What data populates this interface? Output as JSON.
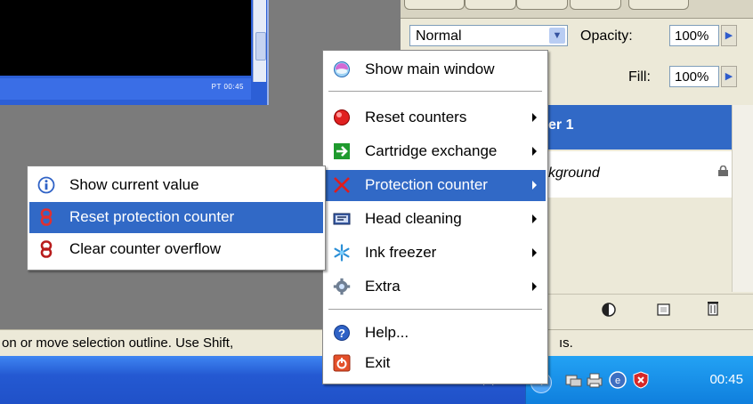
{
  "background": {
    "thumbnail_tray_text": "PT 00:45",
    "layers_panel": {
      "blend_mode": "Normal",
      "opacity_label": "Opacity:",
      "opacity_value": "100%",
      "fill_label": "Fill:",
      "fill_value": "100%",
      "layer_active_name": "er 1",
      "layer_background_name": "kground"
    },
    "status_bar_text": "on or move selection outline.  Use Shift,",
    "status_bar_text_right": "ıs.",
    "tray_clock": "00:45",
    "taskbar_fragment": "PT"
  },
  "main_menu": {
    "items": [
      {
        "label": "Show main window",
        "icon": "main-window-icon",
        "has_submenu": false,
        "highlighted": false
      },
      {
        "label": "Reset counters",
        "icon": "red-ball-icon",
        "has_submenu": true,
        "highlighted": false
      },
      {
        "label": "Cartridge exchange",
        "icon": "green-arrow-icon",
        "has_submenu": true,
        "highlighted": false
      },
      {
        "label": "Protection counter",
        "icon": "red-x-icon",
        "has_submenu": true,
        "highlighted": true
      },
      {
        "label": "Head cleaning",
        "icon": "printer-head-icon",
        "has_submenu": true,
        "highlighted": false
      },
      {
        "label": "Ink freezer",
        "icon": "snowflake-icon",
        "has_submenu": true,
        "highlighted": false
      },
      {
        "label": "Extra",
        "icon": "gear-icon",
        "has_submenu": true,
        "highlighted": false
      },
      {
        "label": "Help...",
        "icon": "help-icon",
        "has_submenu": false,
        "highlighted": false
      },
      {
        "label": "Exit",
        "icon": "exit-icon",
        "has_submenu": false,
        "highlighted": false
      }
    ]
  },
  "sub_menu": {
    "items": [
      {
        "label": "Show current value",
        "icon": "info-icon",
        "highlighted": false
      },
      {
        "label": "Reset protection counter",
        "icon": "chain-link-icon",
        "highlighted": true
      },
      {
        "label": "Clear counter overflow",
        "icon": "chain-link-icon",
        "highlighted": false
      }
    ]
  },
  "colors": {
    "highlight": "#3169c6",
    "taskbar": "#2459d2",
    "tray": "#0f7fdd"
  }
}
